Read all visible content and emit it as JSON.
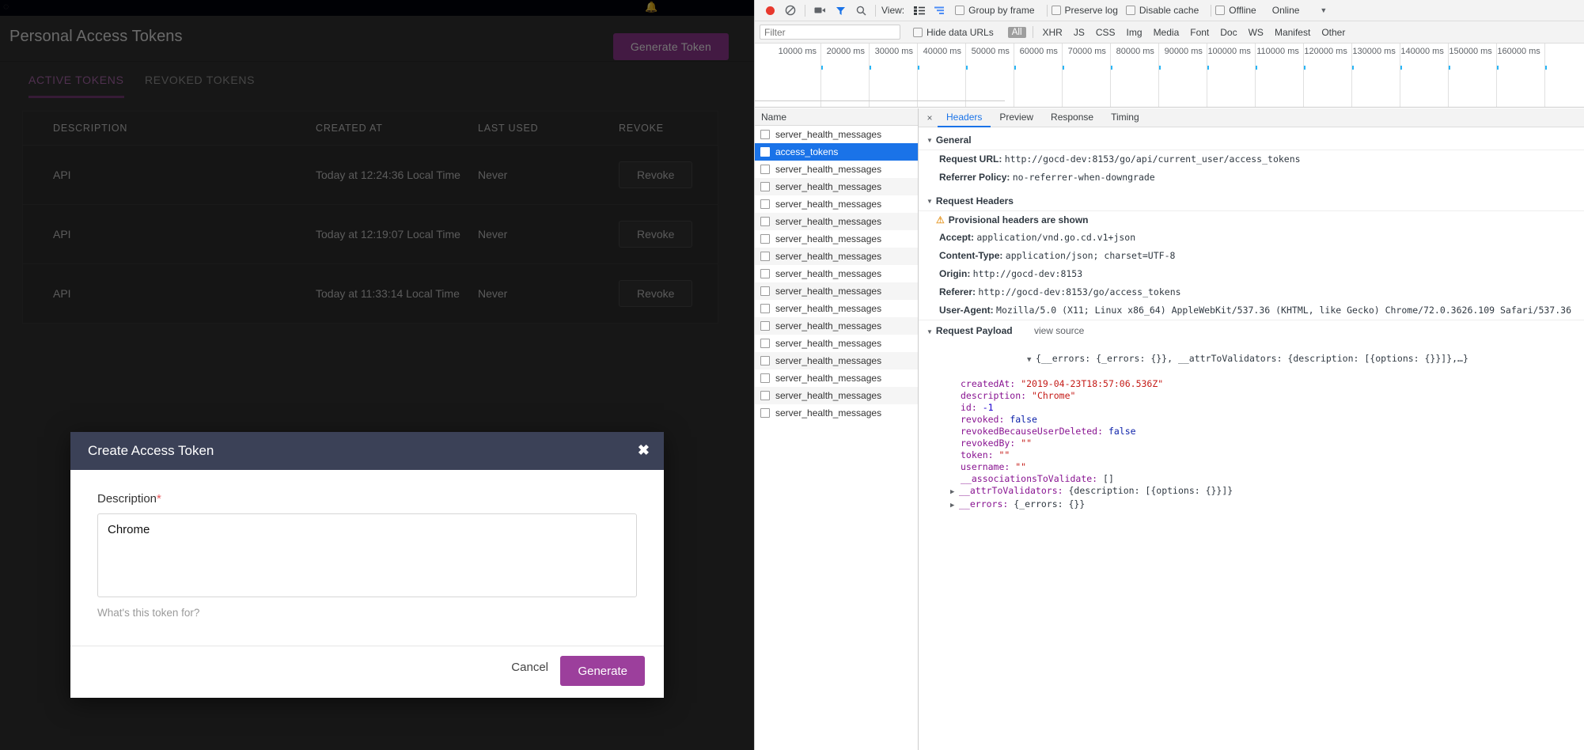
{
  "app": {
    "topbar": {
      "spinner_icon": "spinner-icon",
      "bell_icon": "bell-icon"
    },
    "page_title": "Personal Access Tokens",
    "generate_token_label": "Generate Token",
    "tabs": [
      {
        "label": "ACTIVE TOKENS",
        "active": true
      },
      {
        "label": "REVOKED TOKENS",
        "active": false
      }
    ],
    "table": {
      "columns": [
        "DESCRIPTION",
        "CREATED AT",
        "LAST USED",
        "REVOKE"
      ],
      "rows": [
        {
          "description": "API",
          "created_at": "Today at 12:24:36 Local Time",
          "last_used": "Never",
          "revoke_label": "Revoke"
        },
        {
          "description": "API",
          "created_at": "Today at 12:19:07 Local Time",
          "last_used": "Never",
          "revoke_label": "Revoke"
        },
        {
          "description": "API",
          "created_at": "Today at 11:33:14 Local Time",
          "last_used": "Never",
          "revoke_label": "Revoke"
        }
      ]
    },
    "modal": {
      "title": "Create Access Token",
      "close_icon": "✖",
      "field_label": "Description",
      "required_marker": "*",
      "description_value": "Chrome",
      "description_placeholder": "",
      "help_text": "What's this token for?",
      "cancel_label": "Cancel",
      "generate_label": "Generate"
    }
  },
  "devtools": {
    "toolbar": {
      "record_icon": "record-icon",
      "clear_icon": "clear-icon",
      "camera_icon": "camera-icon",
      "filter_icon": "filter-funnel-icon",
      "search_icon": "search-icon",
      "view_label": "View:",
      "view_list_icon": "list-view-icon",
      "view_waterfall_icon": "waterfall-view-icon",
      "checkboxes": [
        {
          "label": "Group by frame",
          "checked": false
        },
        {
          "label": "Preserve log",
          "checked": false
        },
        {
          "label": "Disable cache",
          "checked": false
        },
        {
          "label": "Offline",
          "checked": false
        }
      ],
      "throttle_value": "Online",
      "caret_icon": "chevron-down-icon"
    },
    "filterbar": {
      "placeholder": "Filter",
      "value": "",
      "hide_data_urls_label": "Hide data URLs",
      "hide_data_urls_checked": false,
      "types": [
        "All",
        "XHR",
        "JS",
        "CSS",
        "Img",
        "Media",
        "Font",
        "Doc",
        "WS",
        "Manifest",
        "Other"
      ],
      "active_type": "All"
    },
    "overview": {
      "ticks": [
        "10000 ms",
        "20000 ms",
        "30000 ms",
        "40000 ms",
        "50000 ms",
        "60000 ms",
        "70000 ms",
        "80000 ms",
        "90000 ms",
        "100000 ms",
        "110000 ms",
        "120000 ms",
        "130000 ms",
        "140000 ms",
        "150000 ms",
        "160000 ms"
      ]
    },
    "requests": {
      "header": "Name",
      "items": [
        {
          "name": "server_health_messages",
          "selected": false
        },
        {
          "name": "access_tokens",
          "selected": true
        },
        {
          "name": "server_health_messages",
          "selected": false
        },
        {
          "name": "server_health_messages",
          "selected": false
        },
        {
          "name": "server_health_messages",
          "selected": false
        },
        {
          "name": "server_health_messages",
          "selected": false
        },
        {
          "name": "server_health_messages",
          "selected": false
        },
        {
          "name": "server_health_messages",
          "selected": false
        },
        {
          "name": "server_health_messages",
          "selected": false
        },
        {
          "name": "server_health_messages",
          "selected": false
        },
        {
          "name": "server_health_messages",
          "selected": false
        },
        {
          "name": "server_health_messages",
          "selected": false
        },
        {
          "name": "server_health_messages",
          "selected": false
        },
        {
          "name": "server_health_messages",
          "selected": false
        },
        {
          "name": "server_health_messages",
          "selected": false
        },
        {
          "name": "server_health_messages",
          "selected": false
        },
        {
          "name": "server_health_messages",
          "selected": false
        }
      ]
    },
    "details": {
      "close_icon": "×",
      "tabs": [
        {
          "label": "Headers",
          "active": true
        },
        {
          "label": "Preview",
          "active": false
        },
        {
          "label": "Response",
          "active": false
        },
        {
          "label": "Timing",
          "active": false
        }
      ],
      "general": {
        "section": "General",
        "request_url_key": "Request URL:",
        "request_url_val": "http://gocd-dev:8153/go/api/current_user/access_tokens",
        "referrer_policy_key": "Referrer Policy:",
        "referrer_policy_val": "no-referrer-when-downgrade"
      },
      "request_headers": {
        "section": "Request Headers",
        "warning": "Provisional headers are shown",
        "warning_icon": "warning-triangle-icon",
        "items": [
          {
            "key": "Accept:",
            "value": "application/vnd.go.cd.v1+json"
          },
          {
            "key": "Content-Type:",
            "value": "application/json; charset=UTF-8"
          },
          {
            "key": "Origin:",
            "value": "http://gocd-dev:8153"
          },
          {
            "key": "Referer:",
            "value": "http://gocd-dev:8153/go/access_tokens"
          },
          {
            "key": "User-Agent:",
            "value": "Mozilla/5.0 (X11; Linux x86_64) AppleWebKit/537.36 (KHTML, like Gecko) Chrome/72.0.3626.109 Safari/537.36"
          }
        ]
      },
      "request_payload": {
        "section": "Request Payload",
        "view_source": "view source",
        "root": "{__errors: {_errors: {}}, __attrToValidators: {description: [{options: {}}]},…}",
        "entries": [
          {
            "key": "createdAt:",
            "value": "\"2019-04-23T18:57:06.536Z\"",
            "type": "string"
          },
          {
            "key": "description:",
            "value": "\"Chrome\"",
            "type": "string"
          },
          {
            "key": "id:",
            "value": "-1",
            "type": "number"
          },
          {
            "key": "revoked:",
            "value": "false",
            "type": "bool"
          },
          {
            "key": "revokedBecauseUserDeleted:",
            "value": "false",
            "type": "bool"
          },
          {
            "key": "revokedBy:",
            "value": "\"\"",
            "type": "string"
          },
          {
            "key": "token:",
            "value": "\"\"",
            "type": "string"
          },
          {
            "key": "username:",
            "value": "\"\"",
            "type": "string"
          },
          {
            "key": "__associationsToValidate:",
            "value": "[]",
            "type": "plain"
          }
        ],
        "collapsed": [
          {
            "key": "__attrToValidators:",
            "value": "{description: [{options: {}}]}"
          },
          {
            "key": "__errors:",
            "value": "{_errors: {}}"
          }
        ]
      }
    }
  }
}
